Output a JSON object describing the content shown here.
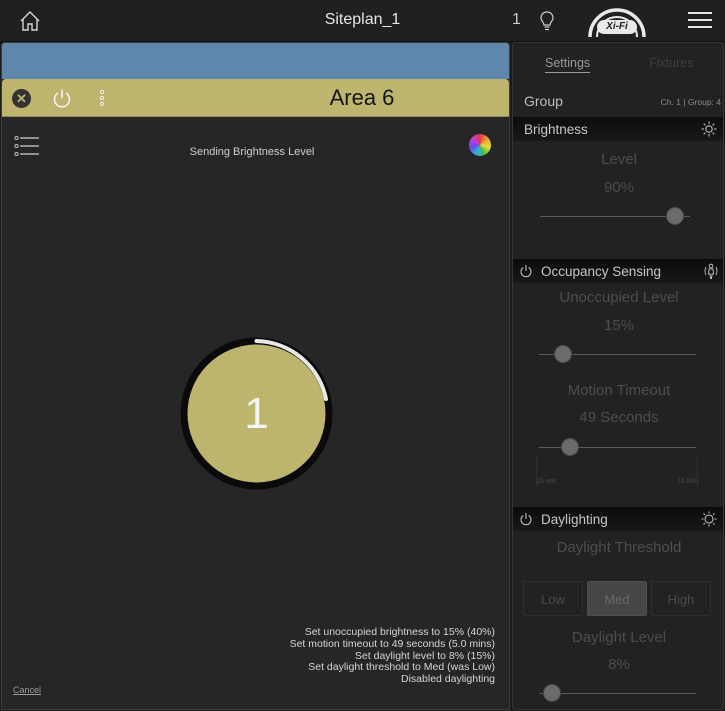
{
  "topbar": {
    "title": "Siteplan_1",
    "count": "1",
    "logo_text": "Xi-Fi"
  },
  "area": {
    "title": "Area 6",
    "status": "Sending Brightness Level",
    "dial_value": "1",
    "cancel_label": "Cancel",
    "header_color": "#bdb56e",
    "log": [
      "Set unoccupied brightness to 15% (40%)",
      "Set motion timeout to 49 seconds (5.0 mins)",
      "Set daylight level to 8% (15%)",
      "Set daylight threshold to Med (was Low)",
      "Disabled daylighting"
    ]
  },
  "settings": {
    "tabs": {
      "settings": "Settings",
      "fixtures": "Fixtures"
    },
    "group_label": "Group",
    "group_meta": "Ch. 1 | Group: 4",
    "brightness": {
      "title": "Brightness",
      "level_label": "Level",
      "level_value": "90%",
      "level_fraction": 0.9
    },
    "occupancy": {
      "title": "Occupancy Sensing",
      "unoccupied_label": "Unoccupied Level",
      "unoccupied_value": "15%",
      "unoccupied_fraction": 0.15,
      "timeout_label": "Motion Timeout",
      "timeout_value": "49 Seconds",
      "timeout_fraction": 0.2,
      "scale_min": "15 sec",
      "scale_max": "15 Min"
    },
    "daylighting": {
      "title": "Daylighting",
      "threshold_label": "Daylight Threshold",
      "thresholds": [
        "Low",
        "Med",
        "High"
      ],
      "selected_threshold": "Med",
      "level_label": "Daylight Level",
      "level_value": "8%",
      "level_fraction": 0.08
    }
  }
}
